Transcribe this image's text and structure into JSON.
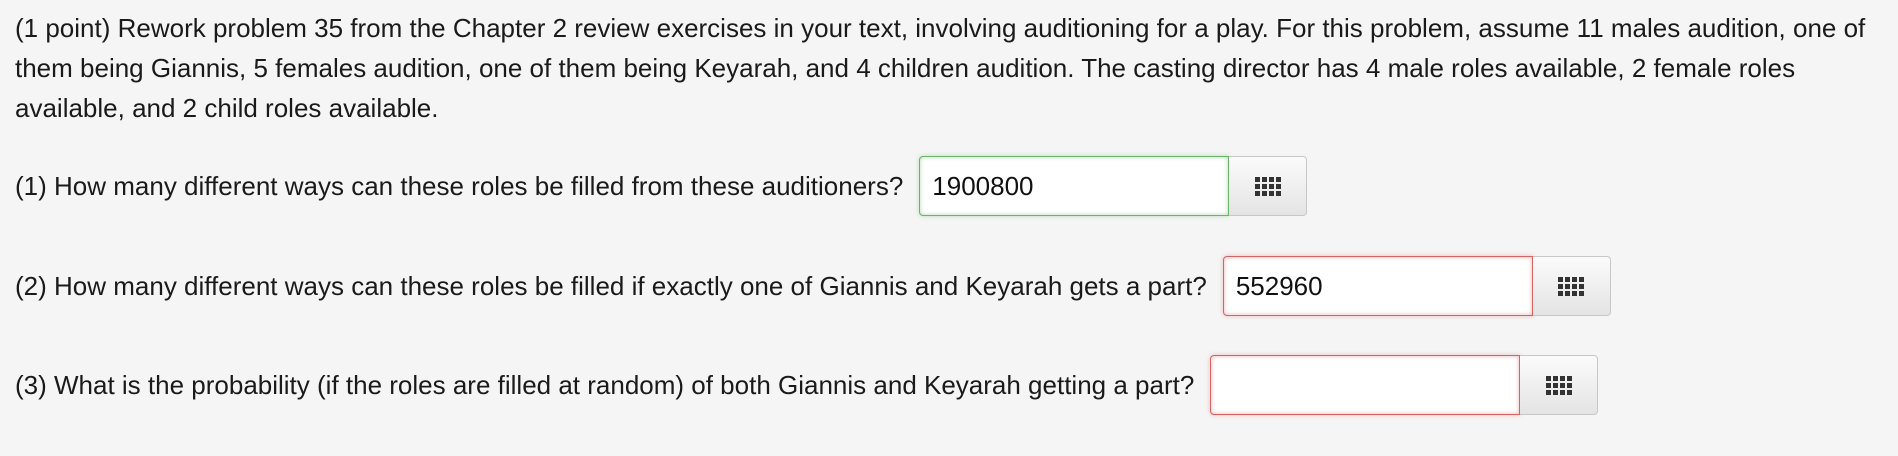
{
  "problem": {
    "text": "(1 point) Rework problem 35 from the Chapter 2 review exercises in your text, involving auditioning for a play. For this problem, assume 11 males audition, one of them being Giannis, 5 females audition, one of them being Keyarah, and 4 children audition. The casting director has 4 male roles available, 2 female roles available, and 2 child roles available."
  },
  "questions": [
    {
      "label": "(1) How many different ways can these roles be filled from these auditioners?",
      "value": "1900800",
      "status": "correct",
      "button_icon": "grid-icon"
    },
    {
      "label": "(2) How many different ways can these roles be filled if exactly one of Giannis and Keyarah gets a part?",
      "value": "552960",
      "status": "incorrect",
      "button_icon": "grid-icon"
    },
    {
      "label": "(3) What is the probability (if the roles are filled at random) of both Giannis and Keyarah getting a part?",
      "value": "",
      "status": "incorrect",
      "button_icon": "grid-icon"
    }
  ],
  "colors": {
    "background": "#f5f5f5",
    "correct_border": "#6bb56b",
    "incorrect_border": "#d46565"
  }
}
